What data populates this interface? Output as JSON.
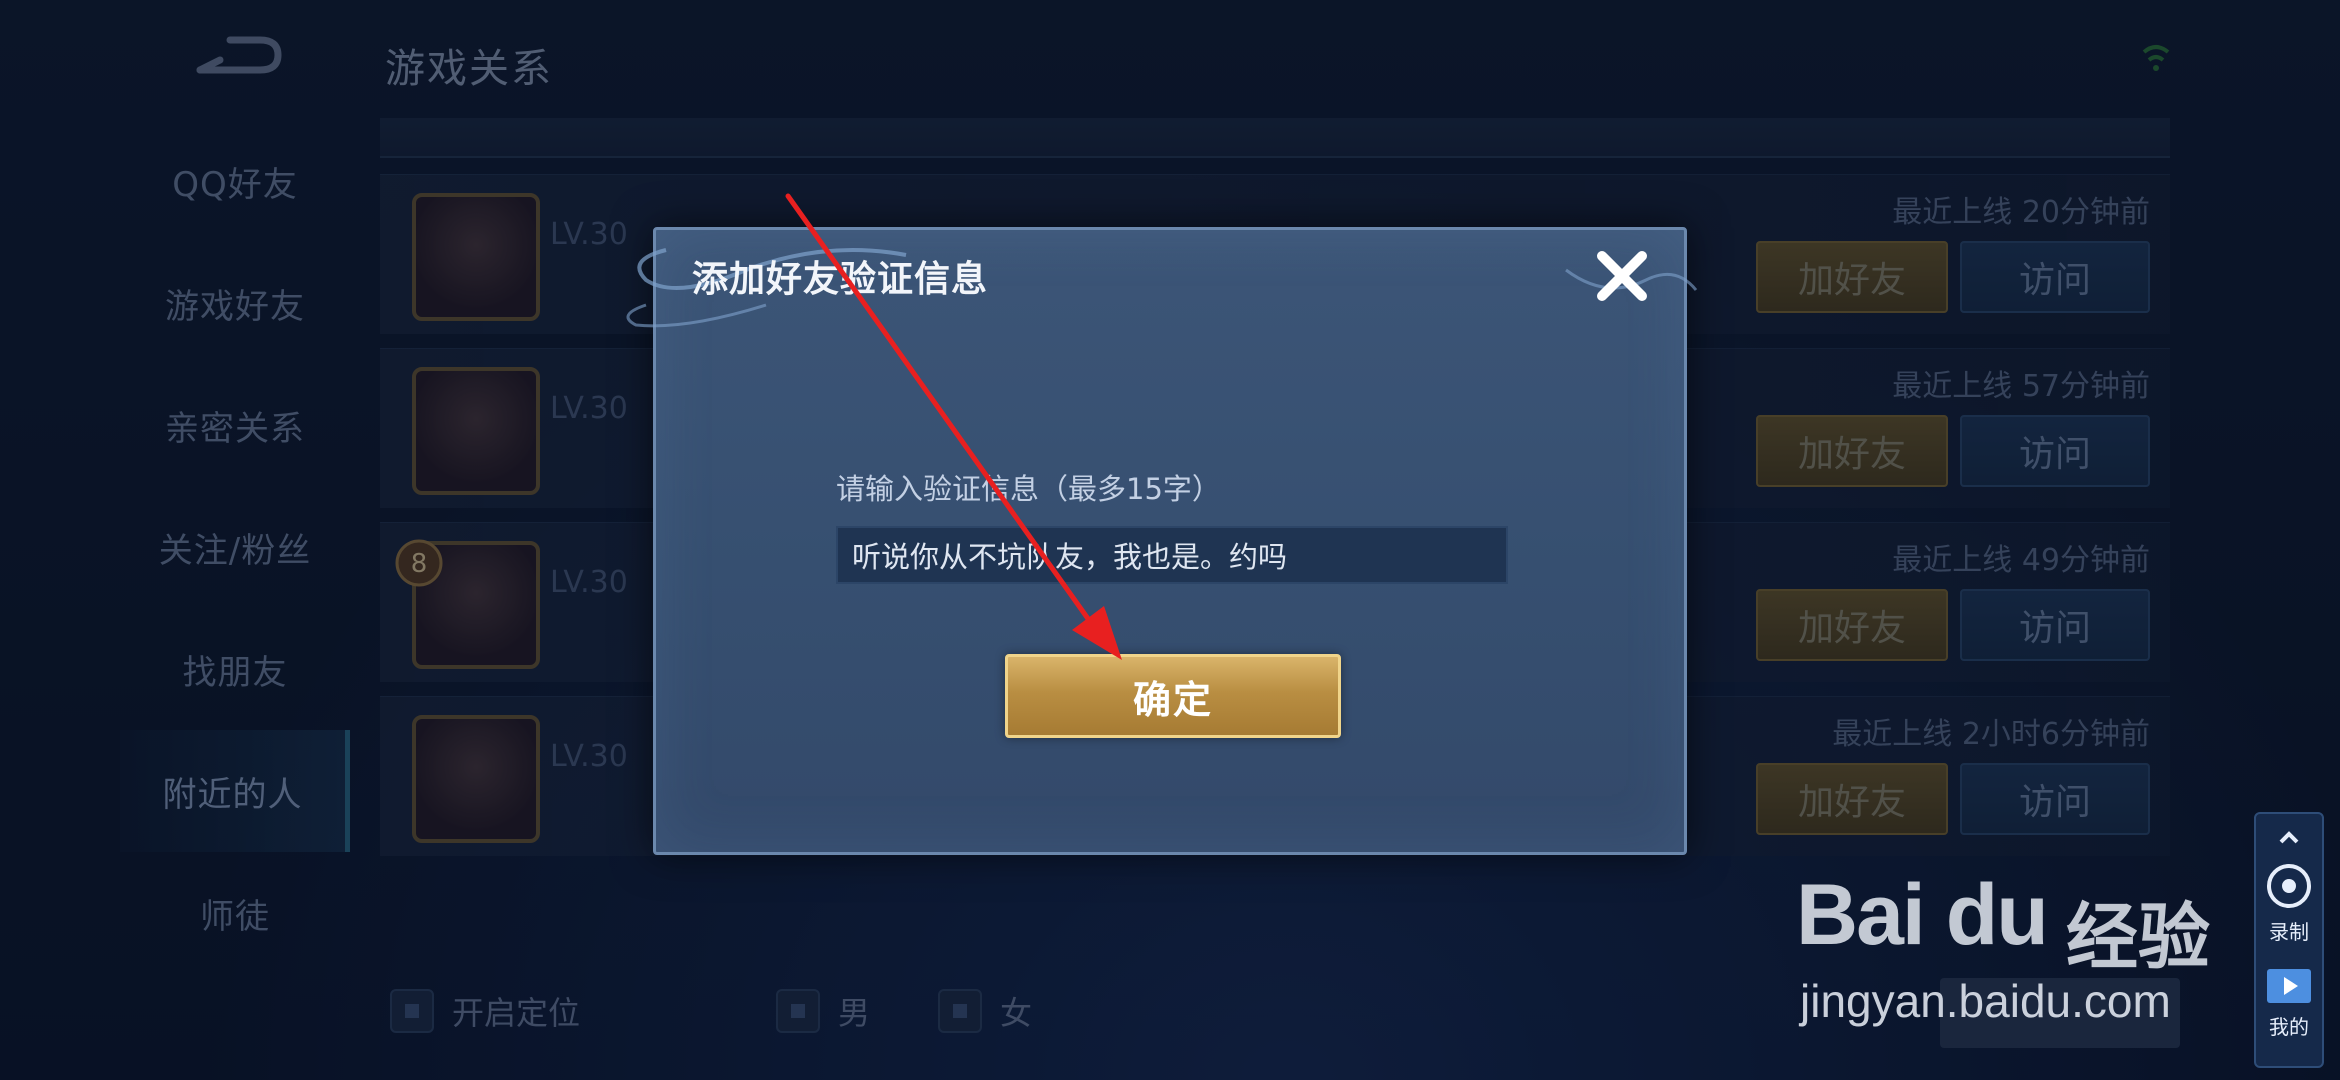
{
  "header": {
    "title": "游戏关系"
  },
  "sidebar": {
    "items": [
      {
        "label": "QQ好友"
      },
      {
        "label": "游戏好友"
      },
      {
        "label": "亲密关系"
      },
      {
        "label": "关注/粉丝"
      },
      {
        "label": "找朋友"
      },
      {
        "label": "附近的人"
      },
      {
        "label": "师徒"
      }
    ],
    "active_index": 5
  },
  "list": {
    "rows": [
      {
        "level": "LV.30",
        "last_online": "最近上线  20分钟前",
        "add_label": "加好友",
        "visit_label": "访问"
      },
      {
        "level": "LV.30",
        "last_online": "最近上线  57分钟前",
        "add_label": "加好友",
        "visit_label": "访问"
      },
      {
        "level": "LV.30",
        "last_online": "最近上线  49分钟前",
        "add_label": "加好友",
        "visit_label": "访问",
        "badge": "8"
      },
      {
        "level": "LV.30",
        "last_online": "最近上线  2小时6分钟前",
        "add_label": "加好友",
        "visit_label": "访问"
      }
    ]
  },
  "filters": {
    "location": "开启定位",
    "male": "男",
    "female": "女"
  },
  "dialog": {
    "title": "添加好友验证信息",
    "prompt": "请输入验证信息（最多15字）",
    "input_value": "听说你从不坑队友，我也是。约吗",
    "confirm_label": "确定"
  },
  "recorder": {
    "record_label": "录制",
    "mine_label": "我的"
  },
  "watermark": {
    "brand": "Bai du",
    "suffix": "经验",
    "url": "jingyan.baidu.com"
  },
  "colors": {
    "accent_gold": "#c59a4e",
    "annotation_arrow": "#e82020"
  }
}
